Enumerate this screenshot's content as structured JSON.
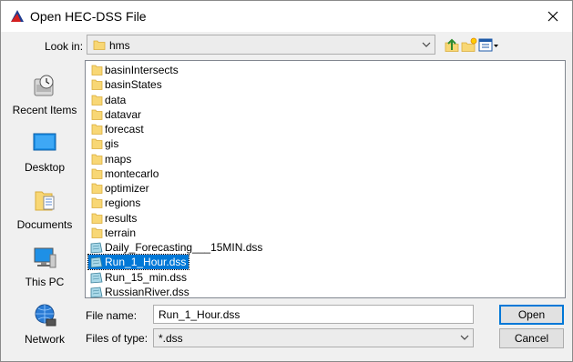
{
  "window": {
    "title": "Open HEC-DSS File"
  },
  "toolbar": {
    "look_in_label": "Look in:",
    "look_in_value": "hms"
  },
  "places": [
    {
      "label": "Recent Items",
      "icon": "recent-items-icon"
    },
    {
      "label": "Desktop",
      "icon": "desktop-icon"
    },
    {
      "label": "Documents",
      "icon": "documents-icon"
    },
    {
      "label": "This PC",
      "icon": "this-pc-icon"
    },
    {
      "label": "Network",
      "icon": "network-icon"
    }
  ],
  "files": [
    {
      "name": "basinIntersects",
      "type": "folder"
    },
    {
      "name": "basinStates",
      "type": "folder"
    },
    {
      "name": "data",
      "type": "folder"
    },
    {
      "name": "datavar",
      "type": "folder"
    },
    {
      "name": "forecast",
      "type": "folder"
    },
    {
      "name": "gis",
      "type": "folder"
    },
    {
      "name": "maps",
      "type": "folder"
    },
    {
      "name": "montecarlo",
      "type": "folder"
    },
    {
      "name": "optimizer",
      "type": "folder"
    },
    {
      "name": "regions",
      "type": "folder"
    },
    {
      "name": "results",
      "type": "folder"
    },
    {
      "name": "terrain",
      "type": "folder"
    },
    {
      "name": "Daily_Forecasting___15MIN.dss",
      "type": "dss"
    },
    {
      "name": "Run_1_Hour.dss",
      "type": "dss",
      "selected": true
    },
    {
      "name": "Run_15_min.dss",
      "type": "dss"
    },
    {
      "name": "RussianRiver.dss",
      "type": "dss"
    }
  ],
  "file_name": {
    "label": "File name:",
    "value": "Run_1_Hour.dss"
  },
  "file_type": {
    "label": "Files of type:",
    "value": "*.dss"
  },
  "buttons": {
    "open": "Open",
    "cancel": "Cancel"
  },
  "colors": {
    "selection": "#0078d7",
    "folder": "#f8d775",
    "default_button_border": "#0078d7"
  }
}
